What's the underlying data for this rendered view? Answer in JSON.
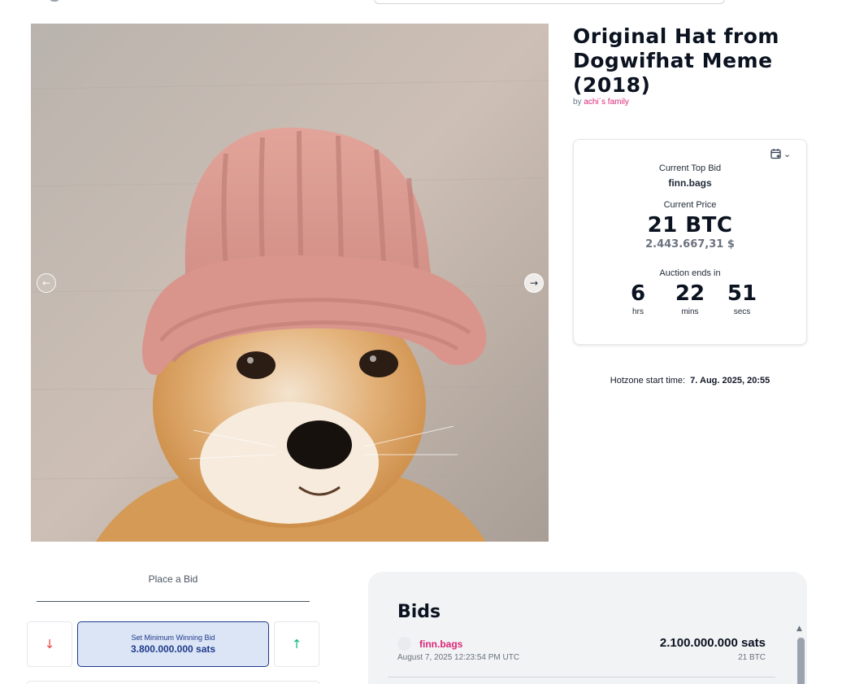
{
  "listing": {
    "title": "Original Hat from Dogwifhat Meme (2018)",
    "by_prefix": "by",
    "author": "achi´s family"
  },
  "gallery": {
    "prev_icon": "arrow-left-icon",
    "next_icon": "arrow-right-icon",
    "prev_glyph": "←",
    "next_glyph": "→"
  },
  "auction": {
    "calendar_icon": "calendar-add-icon",
    "calendar_glyph": "📅",
    "chevron_glyph": "⌄",
    "current_top_bid_label": "Current Top Bid",
    "top_bidder": "finn.bags",
    "current_price_label": "Current Price",
    "current_price": "21 BTC",
    "current_price_usd": "2.443.667,31 $",
    "auction_ends_label": "Auction ends in",
    "countdown": [
      {
        "value": "6",
        "unit": "hrs"
      },
      {
        "value": "22",
        "unit": "mins"
      },
      {
        "value": "51",
        "unit": "secs"
      }
    ],
    "hotzone_label": "Hotzone start time:",
    "hotzone_value": "7. Aug. 2025, 20:55"
  },
  "place_bid": {
    "label": "Place a Bid",
    "decrease_glyph": "↓",
    "increase_glyph": "↑",
    "min_bid_label": "Set Minimum Winning Bid",
    "min_bid_value": "3.800.000.000 sats"
  },
  "bids": {
    "title": "Bids",
    "items": [
      {
        "bidder": "finn.bags",
        "time": "August 7, 2025 12:23:54 PM UTC",
        "amount_sats": "2.100.000.000 sats",
        "amount_btc": "21 BTC"
      }
    ],
    "scroll_up_glyph": "▲"
  },
  "colors": {
    "accent_pink": "#db2777",
    "min_bid_bg": "#dbe5f5",
    "min_bid_border": "#1e3a8a",
    "decrease": "#ef4444",
    "increase": "#10b981"
  }
}
